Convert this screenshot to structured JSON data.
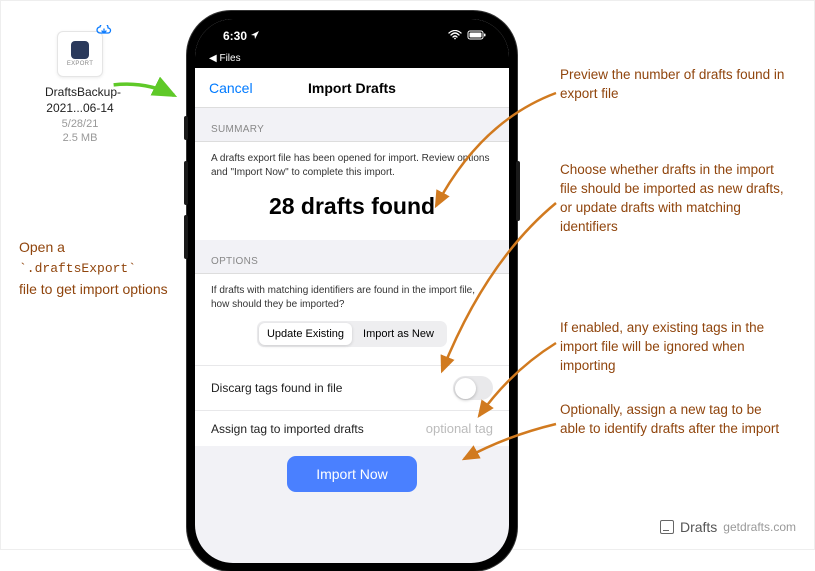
{
  "file": {
    "thumb_label": "EXPORT",
    "name": "DraftsBackup-2021...06-14",
    "date": "5/28/21",
    "size": "2.5 MB"
  },
  "left_instruction": {
    "line1": "Open a",
    "code": "`.draftsExport`",
    "line2": "file to get import options"
  },
  "statusbar": {
    "time": "6:30",
    "back": "◀ Files"
  },
  "navbar": {
    "cancel": "Cancel",
    "title": "Import Drafts"
  },
  "summary": {
    "header": "SUMMARY",
    "desc": "A drafts export file has been opened for import. Review options and \"Import Now\" to complete this import.",
    "found": "28 drafts found"
  },
  "options": {
    "header": "OPTIONS",
    "desc": "If drafts with matching identifiers are found in the import file, how should they be imported?",
    "seg_update": "Update Existing",
    "seg_new": "Import as New",
    "discard_label": "Discarg tags found in file",
    "assign_label": "Assign tag to imported drafts",
    "assign_placeholder": "optional tag",
    "import_btn": "Import Now"
  },
  "annotations": {
    "a1": "Preview the number of drafts found in export file",
    "a2": "Choose whether drafts in the import file should be imported as new drafts, or update drafts with matching identifiers",
    "a3": "If enabled, any existing tags in the import file will be ignored when importing",
    "a4": "Optionally, assign a new tag to be able to identify drafts after the import"
  },
  "brand": {
    "name": "Drafts",
    "url": "getdrafts.com"
  }
}
